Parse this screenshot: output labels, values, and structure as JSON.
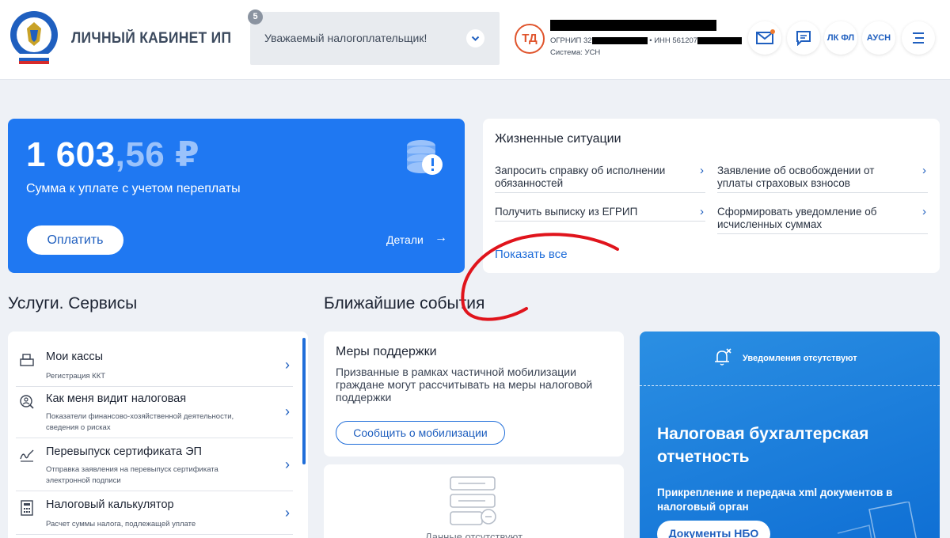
{
  "header": {
    "brand": "ЛИЧНЫЙ КАБИНЕТ ИП",
    "notifications_count": "5",
    "notice_text": "Уважаемый налогоплательщик!",
    "user_initials": "ТД",
    "ogrnip_label": "ОГРНИП 32",
    "inn_label": "• ИНН 561207",
    "system": "Система: УСН",
    "btn_lkfl": "ЛК ФЛ",
    "btn_ausn": "АУСН",
    "accent": "#1f5fbf"
  },
  "balance": {
    "amount_int": "1 603",
    "amount_frac": ",56 ₽",
    "label": "Сумма к уплате с учетом переплаты",
    "pay_button": "Оплатить",
    "details_link": "Детали",
    "bg_color": "#1f78f2"
  },
  "life_situations": {
    "title": "Жизненные ситуации",
    "items": [
      "Запросить справку об исполнении обязанностей",
      "Заявление об освобождении от уплаты страховых взносов",
      "Получить выписку из ЕГРИП",
      "Сформировать уведомление об исчисленных суммах"
    ],
    "show_all": "Показать все"
  },
  "services": {
    "title": "Услуги. Сервисы",
    "items": [
      {
        "title": "Мои кассы",
        "subtitle": "Регистрация ККТ"
      },
      {
        "title": "Как меня видит налоговая",
        "subtitle": "Показатели финансово-хозяйственной деятельности, сведения о рисках"
      },
      {
        "title": "Перевыпуск сертификата ЭП",
        "subtitle": "Отправка заявления на перевыпуск сертификата электронной подписи"
      },
      {
        "title": "Налоговый калькулятор",
        "subtitle": "Расчет суммы налога, подлежащей уплате"
      }
    ]
  },
  "events": {
    "title": "Ближайшие события",
    "support_title": "Меры поддержки",
    "support_text": "Призванные в рамках частичной мобилизации граждане могут рассчитывать на меры налоговой поддержки",
    "support_button": "Сообщить о мобилизации",
    "empty_text": "Данные отсутствуют"
  },
  "promo": {
    "notifications": "Уведомления отсутствуют",
    "title": "Налоговая бухгалтерская отчетность",
    "text": "Прикрепление и передача xml документов в налоговый орган",
    "button": "Документы НБО"
  }
}
